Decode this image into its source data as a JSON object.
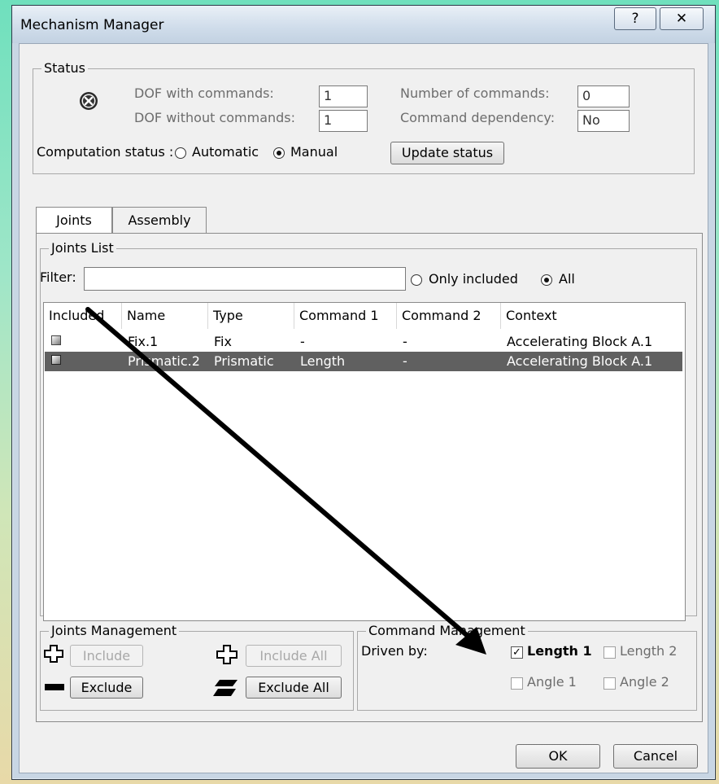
{
  "window": {
    "title": "Mechanism Manager",
    "help_btn": "?",
    "close_btn": "✕"
  },
  "status": {
    "legend": "Status",
    "dof_with_label": "DOF with commands:",
    "dof_with_value": "1",
    "dof_without_label": "DOF without commands:",
    "dof_without_value": "1",
    "num_commands_label": "Number of commands:",
    "num_commands_value": "0",
    "cmd_dep_label": "Command dependency:",
    "cmd_dep_value": "No",
    "comp_label": "Computation status :",
    "automatic": "Automatic",
    "manual": "Manual",
    "update_btn": "Update status"
  },
  "tabs": [
    "Joints",
    "Assembly"
  ],
  "joints_list": {
    "legend": "Joints List",
    "filter_label": "Filter:",
    "filter_value": "",
    "only_included": "Only included",
    "all": "All",
    "columns": [
      "Included",
      "Name",
      "Type",
      "Command 1",
      "Command 2",
      "Context"
    ],
    "rows": [
      {
        "name": "Fix.1",
        "type": "Fix",
        "cmd1": "-",
        "cmd2": "-",
        "context": "Accelerating Block A.1",
        "selected": false
      },
      {
        "name": "Prismatic.2",
        "type": "Prismatic",
        "cmd1": "Length",
        "cmd2": "-",
        "context": "Accelerating Block A.1",
        "selected": true
      }
    ]
  },
  "joints_mgmt": {
    "legend": "Joints Management",
    "include": "Include",
    "include_all": "Include All",
    "exclude": "Exclude",
    "exclude_all": "Exclude All"
  },
  "cmd_mgmt": {
    "legend": "Command Management",
    "driven_by": "Driven by:",
    "length1": "Length 1",
    "length2": "Length 2",
    "angle1": "Angle 1",
    "angle2": "Angle 2"
  },
  "footer": {
    "ok": "OK",
    "cancel": "Cancel"
  },
  "icons": [
    "error-icon",
    "plus-icon",
    "minus-icon",
    "annotation-arrow"
  ]
}
